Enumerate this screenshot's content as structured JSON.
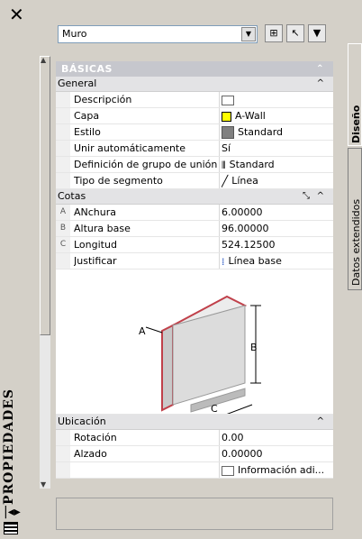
{
  "palette": {
    "title": "PROPIEDADES"
  },
  "selector": {
    "value": "Muro"
  },
  "tabs": [
    {
      "label": "Diseño"
    },
    {
      "label": "Datos extendidos"
    }
  ],
  "section": {
    "title": "BÁSICAS"
  },
  "general": {
    "title": "General",
    "rows": [
      {
        "label": "Descripción",
        "value": ""
      },
      {
        "label": "Capa",
        "value": "A-Wall"
      },
      {
        "label": "Estilo",
        "value": "Standard"
      },
      {
        "label": "Unir automáticamente",
        "value": "Sí"
      },
      {
        "label": "Definición de grupo de unión",
        "value": "Standard"
      },
      {
        "label": "Tipo de segmento",
        "value": "Línea"
      }
    ]
  },
  "cotas": {
    "title": "Cotas",
    "rows": [
      {
        "key": "A",
        "label": "ANchura",
        "value": "6.00000"
      },
      {
        "key": "B",
        "label": "Altura base",
        "value": "96.00000"
      },
      {
        "key": "C",
        "label": "Longitud",
        "value": "524.12500"
      },
      {
        "key": "",
        "label": "Justificar",
        "value": "Línea base"
      }
    ],
    "diagram_labels": {
      "a": "A",
      "b": "B",
      "c": "C"
    }
  },
  "ubicacion": {
    "title": "Ubicación",
    "rows": [
      {
        "label": "Rotación",
        "value": "0.00"
      },
      {
        "label": "Alzado",
        "value": "0.00000"
      },
      {
        "label": "",
        "value": "Información adi..."
      }
    ]
  },
  "colors": {
    "layer_swatch": "#ffff00",
    "header": "#c6c7cd",
    "wall_edge": "#c0404a"
  }
}
